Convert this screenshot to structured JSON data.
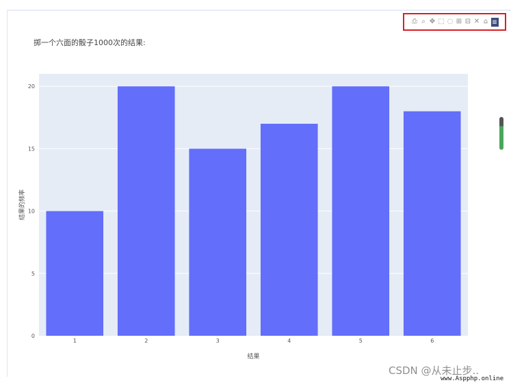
{
  "toolbar": {
    "buttons": [
      {
        "name": "download-plot-icon",
        "glyph": "⎙",
        "active": false
      },
      {
        "name": "zoom-icon",
        "glyph": "⌕",
        "active": false
      },
      {
        "name": "pan-icon",
        "glyph": "✥",
        "active": false
      },
      {
        "name": "box-select-icon",
        "glyph": "⬚",
        "active": false
      },
      {
        "name": "lasso-select-icon",
        "glyph": "◌",
        "active": false
      },
      {
        "name": "zoom-in-icon",
        "glyph": "⊞",
        "active": false
      },
      {
        "name": "zoom-out-icon",
        "glyph": "⊟",
        "active": false
      },
      {
        "name": "autoscale-icon",
        "glyph": "✕",
        "active": false
      },
      {
        "name": "reset-axes-icon",
        "glyph": "⌂",
        "active": false
      },
      {
        "name": "plotly-logo-icon",
        "glyph": "▥",
        "active": true
      }
    ]
  },
  "chart_data": {
    "type": "bar",
    "title": "掷一个六面的骰子1000次的结果:",
    "categories": [
      "1",
      "2",
      "3",
      "4",
      "5",
      "6"
    ],
    "values": [
      10,
      20,
      15,
      17,
      20,
      18
    ],
    "xlabel": "结果",
    "ylabel": "结果的频率",
    "ylim": [
      0,
      21
    ],
    "yticks": [
      0,
      5,
      10,
      15,
      20
    ],
    "grid": true,
    "colors": {
      "bar": "#636efa",
      "plot_bg": "#e5ecf6",
      "grid": "#ffffff"
    }
  },
  "watermark": {
    "line1": "CSDN @从未止步..",
    "line2": "www.Aspphp.online"
  }
}
